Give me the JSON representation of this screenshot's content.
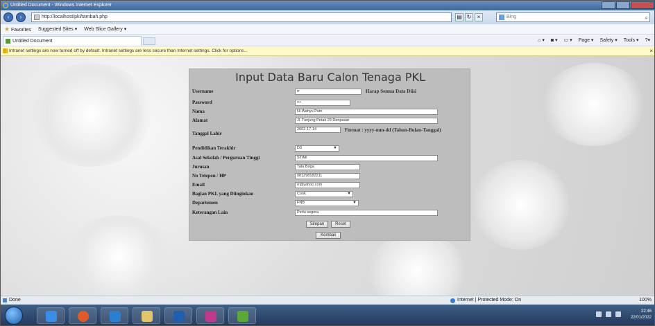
{
  "browser": {
    "title": "Untitled Document - Windows Internet Explorer",
    "address": "http://localhost/pkl/tambah.php",
    "search_placeholder": "Bing",
    "favorites_label": "Favorites",
    "fav_links": [
      "Suggested Sites ▾",
      "Web Slice Gallery ▾"
    ],
    "tab_title": "Untitled Document",
    "commands": [
      "Page ▾",
      "Safety ▾",
      "Tools ▾"
    ],
    "info_bar": "Intranet settings are now turned off by default. Intranet settings are less secure than Internet settings. Click for options...",
    "status_left": "Done",
    "status_zone": "Internet | Protected Mode: On",
    "zoom": "100%"
  },
  "form": {
    "title": "Input Data Baru Calon Tenaga PKL",
    "fields": [
      {
        "label": "Username",
        "value": "rr"
      },
      {
        "label": "Password",
        "value": "•••"
      },
      {
        "label": "Nama",
        "value": "Ni Wahyu Putri"
      },
      {
        "label": "Alamat",
        "value": "Jl. Tunjung Petak 29 Denpasar"
      },
      {
        "label": "Tanggal Lahir",
        "value": "2002-17-14"
      },
      {
        "label": "Pendidikan Terakhir",
        "value": "D3"
      },
      {
        "label": "Asal Sekolah / Perguruan Tinggi",
        "value": "STIMI"
      },
      {
        "label": "Jurusan",
        "value": "Tata Boga"
      },
      {
        "label": "No Telepon / HP",
        "value": "081298182211"
      },
      {
        "label": "Email",
        "value": "rr@yahoo.com"
      },
      {
        "label": "Bagian PKL yang Diinginkan",
        "value": "Cook"
      },
      {
        "label": "Departemen",
        "value": "FNB"
      },
      {
        "label": "Keterangan Lain",
        "value": "Perlu segera"
      }
    ],
    "username_note": "Harap Semua Data Diisi",
    "date_note": "Format : yyyy-mm-dd (Tahun-Bulan-Tanggal)",
    "submit_label": "Simpan",
    "reset_label": "Reset",
    "back_label": "Kembali"
  },
  "taskbar": {
    "time": "22:46",
    "date": "22/01/2022"
  }
}
